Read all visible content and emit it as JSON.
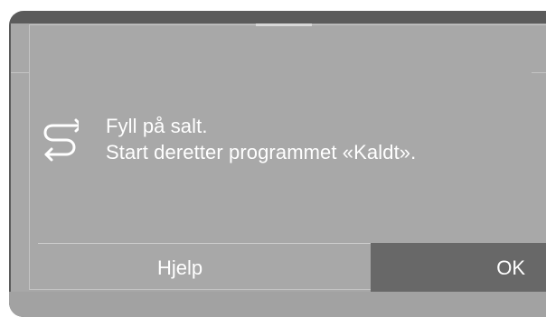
{
  "message": {
    "line1": "Fyll på salt.",
    "line2": "Start deretter programmet «Kaldt».",
    "icon": "swap-arrows-icon"
  },
  "footer": {
    "help_label": "Hjelp",
    "ok_label": "OK"
  },
  "colors": {
    "bezel": "#5b5b5b",
    "screen": "#a8a8a8",
    "ok_button": "#686868",
    "text": "#ffffff"
  }
}
